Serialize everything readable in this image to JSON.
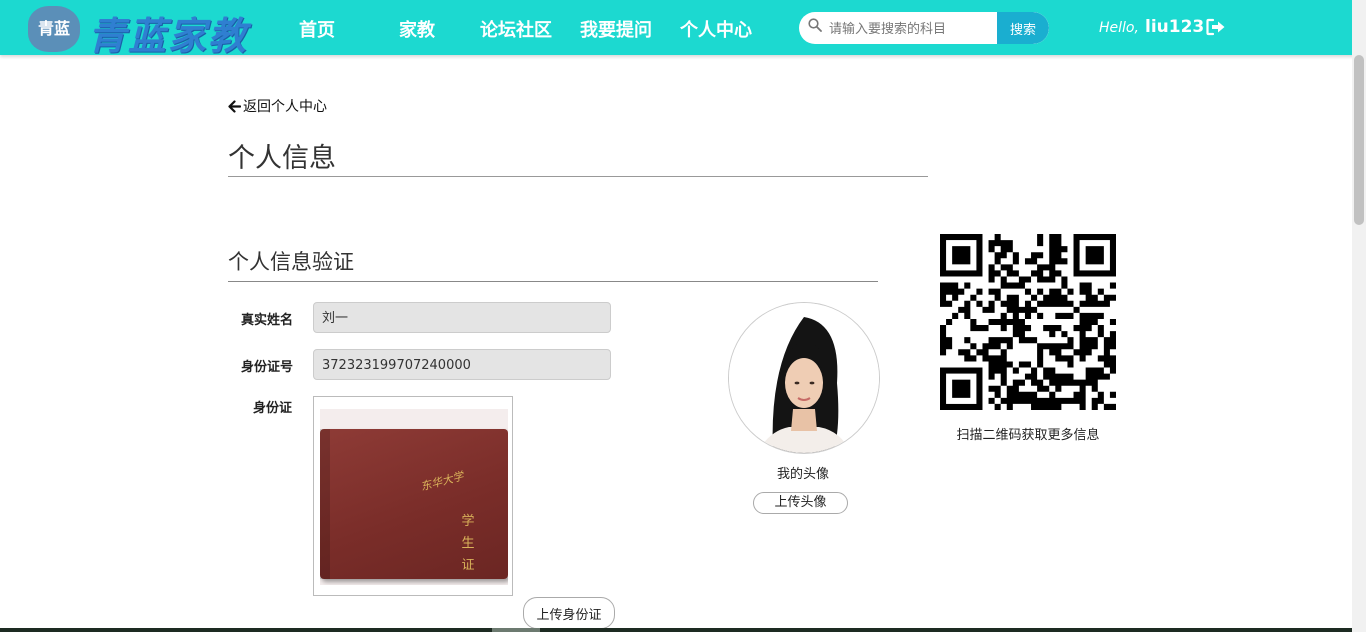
{
  "header": {
    "logo_seal_text": "青蓝",
    "logo_text": "青蓝家教",
    "nav": [
      "首页",
      "家教",
      "论坛社区",
      "我要提问",
      "个人中心"
    ],
    "search": {
      "placeholder": "请输入要搜索的科目",
      "button": "搜索"
    },
    "hello": "Hello,",
    "username": "liu123"
  },
  "page": {
    "back_link": "返回个人中心",
    "title": "个人信息",
    "section_title": "个人信息验证"
  },
  "form": {
    "real_name_label": "真实姓名",
    "real_name_value": "刘一",
    "id_number_label": "身份证号",
    "id_number_value": "372323199707240000",
    "id_card_label": "身份证",
    "upload_id_button": "上传身份证"
  },
  "id_card_image": {
    "cover_text": "东华大学",
    "title_text": "学生证"
  },
  "avatar": {
    "caption": "我的头像",
    "upload_button": "上传头像"
  },
  "qr": {
    "caption": "扫描二维码获取更多信息"
  },
  "colors": {
    "header_bg": "#1cd9d0",
    "search_button": "#1aaed0"
  }
}
